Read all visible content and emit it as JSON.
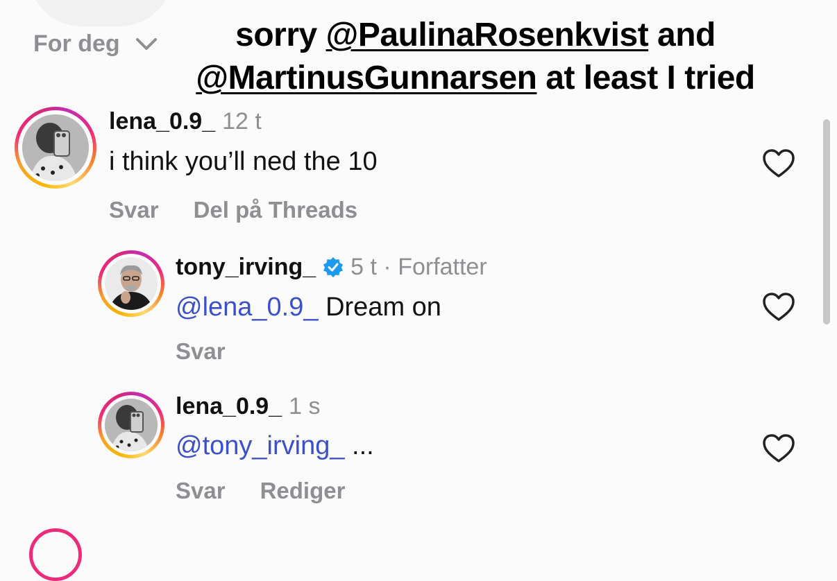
{
  "header": {
    "feed_filter": "For deg",
    "overlay_prefix": "sorry ",
    "overlay_mention1": "@PaulinaRosenkvist",
    "overlay_and": " and",
    "overlay_mention2": "@MartinusGunnarsen",
    "overlay_suffix": " at least I tried"
  },
  "comments": [
    {
      "username": "lena_0.9_",
      "time": "12 t",
      "text": "i think you’ll ned the 10",
      "actions": [
        "Svar",
        "Del på Threads"
      ]
    },
    {
      "username": "tony_irving_",
      "verified": true,
      "time": "5 t · Forfatter",
      "mention": "@lena_0.9_",
      "text": " Dream on",
      "actions": [
        "Svar"
      ]
    },
    {
      "username": "lena_0.9_",
      "time": "1 s",
      "mention": "@tony_irving_",
      "text": " ...",
      "actions": [
        "Svar",
        "Rediger"
      ]
    }
  ],
  "icons": {
    "chevron": "chevron-down-icon",
    "heart": "heart-outline-icon",
    "verified": "verified-badge-icon"
  },
  "colors": {
    "mention": "#3b50c9",
    "secondary_text": "#8e8e93",
    "verified": "#1d9bf0"
  }
}
